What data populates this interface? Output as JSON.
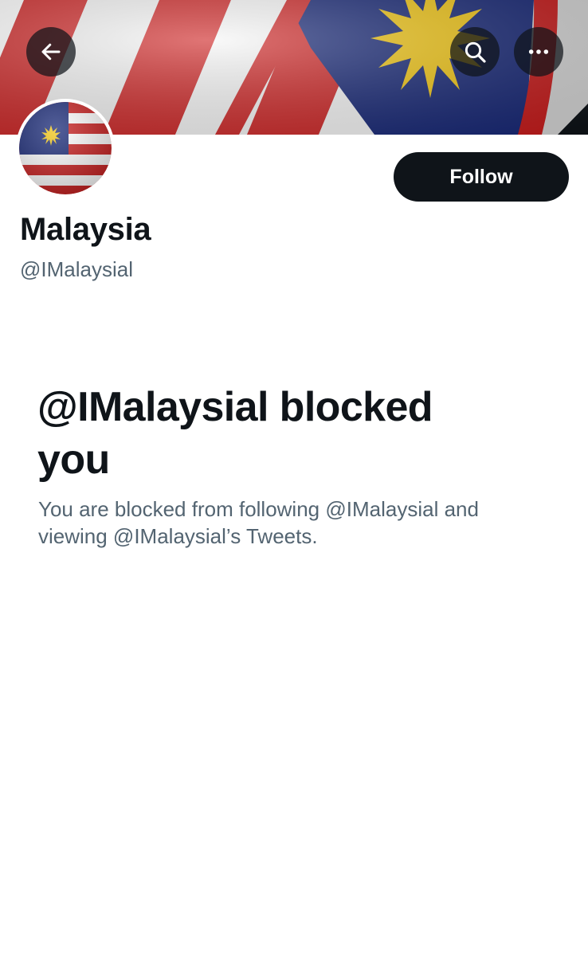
{
  "header": {
    "back_icon": "arrow-left-icon",
    "search_icon": "search-icon",
    "more_icon": "more-horizontal-icon"
  },
  "profile": {
    "display_name": "Malaysia",
    "handle": "@IMalaysial",
    "follow_label": "Follow",
    "avatar": "malaysia-flag-avatar"
  },
  "blocked": {
    "title": "@IMalaysial blocked you",
    "description": "You are blocked from following @IMalaysial and viewing @IMalaysial’s Tweets."
  },
  "colors": {
    "primary_text": "#0f1419",
    "secondary_text": "#536471",
    "button_bg": "#0f1419",
    "button_text": "#ffffff",
    "flag_red": "#cc1f1f",
    "flag_blue": "#1a2a78",
    "flag_yellow": "#f2c718"
  }
}
